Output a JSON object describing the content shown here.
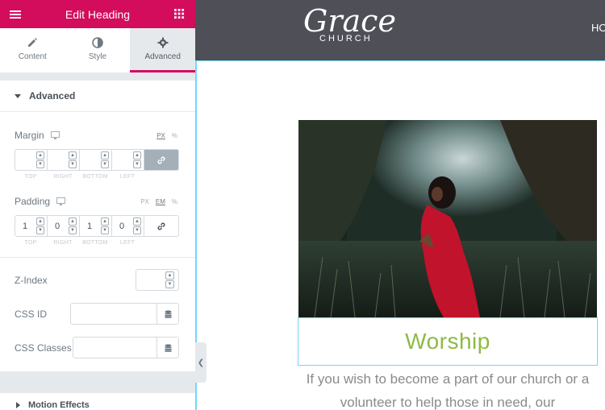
{
  "panel": {
    "title": "Edit Heading",
    "tabs": [
      {
        "label": "Content",
        "icon": "pencil-icon"
      },
      {
        "label": "Style",
        "icon": "contrast-icon"
      },
      {
        "label": "Advanced",
        "icon": "gear-icon",
        "active": true
      }
    ],
    "section_title": "Advanced",
    "margin": {
      "label": "Margin",
      "units": [
        "PX",
        "%"
      ],
      "active_unit": "PX",
      "values": [
        "",
        "",
        "",
        ""
      ],
      "linked": true
    },
    "padding": {
      "label": "Padding",
      "units": [
        "PX",
        "EM",
        "%"
      ],
      "active_unit": "EM",
      "values": [
        "1",
        "0",
        "1",
        "0"
      ],
      "linked": false
    },
    "dimension_labels": [
      "TOP",
      "RIGHT",
      "BOTTOM",
      "LEFT"
    ],
    "z_index": {
      "label": "Z-Index",
      "value": ""
    },
    "css_id": {
      "label": "CSS ID",
      "value": ""
    },
    "css_classes": {
      "label": "CSS Classes",
      "value": ""
    },
    "motion_effects": "Motion Effects"
  },
  "preview": {
    "logo_script": "Grace",
    "logo_sub": "CHURCH",
    "nav_item": "HO",
    "heading": "Worship",
    "paragraph": "If you wish to become a part of our church or a volunteer to help those in need, our"
  },
  "colors": {
    "brand": "#d30c5c",
    "heading_green": "#8dbb44",
    "header_bg": "#4f4f58",
    "edit_outline": "#71d7f7"
  }
}
